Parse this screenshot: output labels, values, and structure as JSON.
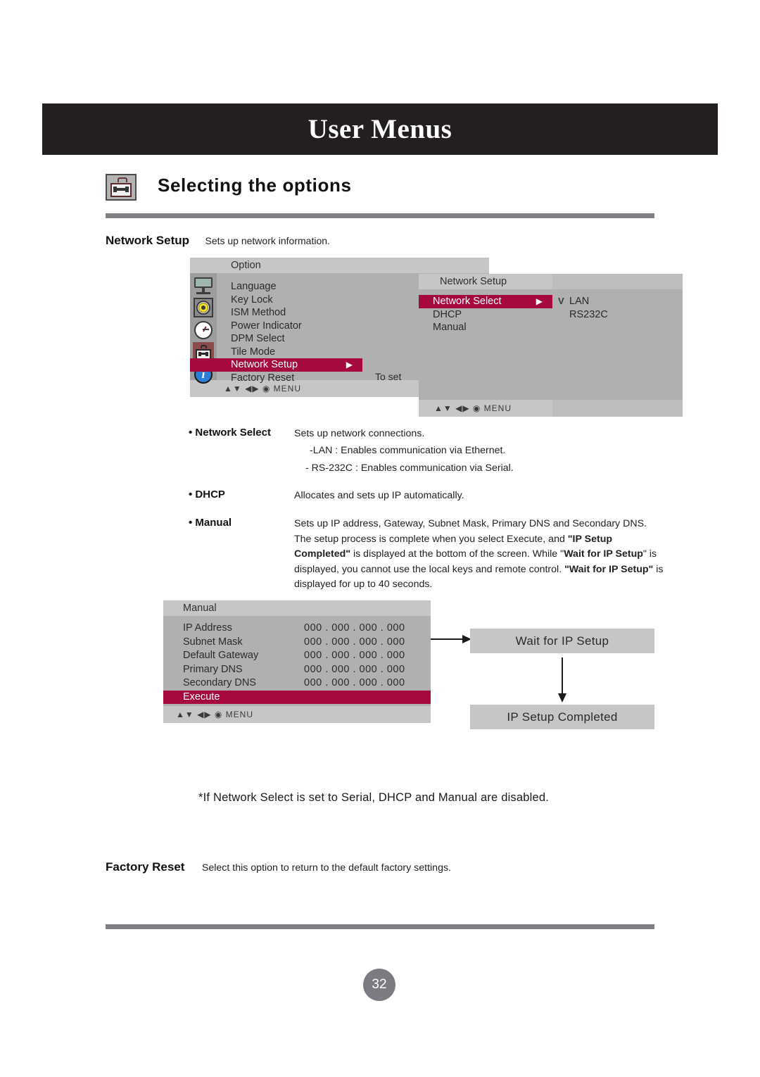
{
  "header": {
    "title": "User Menus"
  },
  "section": {
    "title": "Selecting the options",
    "icon": "toolcase-icon"
  },
  "intro": {
    "label": "Network Setup",
    "desc": "Sets up network information."
  },
  "osd_option": {
    "title": "Option",
    "items": [
      {
        "label": "Language",
        "highlighted": false
      },
      {
        "label": "Key Lock",
        "highlighted": false
      },
      {
        "label": "ISM Method",
        "highlighted": false
      },
      {
        "label": "Power Indicator",
        "highlighted": false
      },
      {
        "label": "DPM Select",
        "highlighted": false
      },
      {
        "label": "Tile Mode",
        "highlighted": false
      },
      {
        "label": "Network Setup",
        "highlighted": true,
        "arrow": "▶"
      },
      {
        "label": "Factory Reset",
        "highlighted": false
      }
    ],
    "nav": "▲▼ ◀▶  ◉  MENU",
    "side_note": "To set",
    "icons": [
      "monitor-icon",
      "disc-icon",
      "clock-icon",
      "toolcase-icon",
      "info-icon"
    ]
  },
  "osd_network": {
    "title": "Network Setup",
    "items": [
      {
        "label": "Network Select",
        "highlighted": true,
        "arrow": "▶"
      },
      {
        "label": "DHCP",
        "highlighted": false
      },
      {
        "label": "Manual",
        "highlighted": false
      }
    ],
    "options": [
      {
        "label": "LAN",
        "checked": true
      },
      {
        "label": "RS232C",
        "checked": false
      }
    ],
    "check_glyph": "V",
    "nav": "▲▼ ◀▶  ◉  MENU"
  },
  "descriptions": [
    {
      "label": "• Network Select",
      "text": "Sets up network connections.",
      "sublines": [
        "-LAN : Enables communication via Ethernet.",
        "- RS-232C : Enables communication via Serial."
      ]
    },
    {
      "label": "• DHCP",
      "text": "Allocates and sets up IP automatically.",
      "sublines": []
    },
    {
      "label": "• Manual",
      "text": "Sets up IP address, Gateway, Subnet Mask, Primary DNS and Secondary DNS.",
      "paragraph_parts": [
        {
          "t": "The setup process is complete when you select Execute, and  ",
          "b": false
        },
        {
          "t": "\"IP Setup Completed\"",
          "b": true
        },
        {
          "t": " is displayed at the bottom of the screen. While \"",
          "b": false
        },
        {
          "t": "Wait for IP Setup",
          "b": true
        },
        {
          "t": "\" is displayed, you cannot use the local keys and remote control. ",
          "b": false
        },
        {
          "t": "\"Wait for IP Setup\"",
          "b": true
        },
        {
          "t": " is displayed for up to 40 seconds.",
          "b": false
        }
      ],
      "sublines": []
    }
  ],
  "osd_manual": {
    "title": "Manual",
    "rows": [
      {
        "key": "IP Address",
        "value": "000 . 000 . 000 . 000"
      },
      {
        "key": "Subnet Mask",
        "value": "000 . 000 . 000 . 000"
      },
      {
        "key": "Default Gateway",
        "value": "000 . 000 . 000 . 000"
      },
      {
        "key": "Primary DNS",
        "value": "000 . 000 . 000 . 000"
      },
      {
        "key": "Secondary DNS",
        "value": "000 . 000 . 000 . 000"
      }
    ],
    "execute_label": "Execute",
    "nav": "▲▼ ◀▶  ◉  MENU"
  },
  "flow": {
    "wait_box": "Wait for IP  Setup",
    "done_box": "IP Setup Completed"
  },
  "note": "*If Network Select is set to Serial, DHCP and Manual are disabled.",
  "factory_reset": {
    "label": "Factory Reset",
    "text": "Select this option to return to the default factory settings."
  },
  "footer": {
    "page": "32"
  },
  "colors": {
    "header_bg": "#231f20",
    "highlight": "#a5093f",
    "osd_body": "#b0b0b0",
    "osd_bar": "#c6c6c6",
    "rule": "#808184",
    "page_badge": "#7b7c81"
  }
}
